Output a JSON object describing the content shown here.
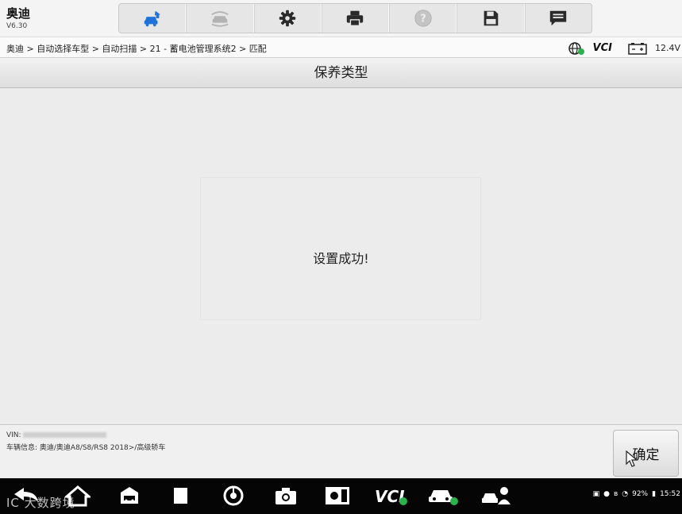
{
  "app": {
    "title": "奥迪",
    "version": "V6.30"
  },
  "toolbar": {
    "items": [
      {
        "name": "home-car-icon"
      },
      {
        "name": "vehicle-swap-icon"
      },
      {
        "name": "settings-gear-icon"
      },
      {
        "name": "printer-icon"
      },
      {
        "name": "help-icon"
      },
      {
        "name": "save-icon"
      },
      {
        "name": "message-icon"
      }
    ]
  },
  "breadcrumb": "奥迪 > 自动选择车型 > 自动扫描 > 21 - 蓄电池管理系统2 > 匹配",
  "status": {
    "vci_label": "VCI",
    "voltage": "12.4V"
  },
  "page_title": "保养类型",
  "message": "设置成功!",
  "vehicle_info": {
    "vin_label": "VIN:",
    "details": "车辆信息: 奥迪/奥迪A8/S8/RS8 2018>/高级轿车"
  },
  "ok_button": "确定",
  "nav": {
    "vci_label": "VCI",
    "watermark": "IC 大数跨境"
  },
  "system_status": {
    "battery": "92%",
    "time": "15:52"
  },
  "colors": {
    "accent": "#1e73d8",
    "connected": "#2bb24c"
  }
}
